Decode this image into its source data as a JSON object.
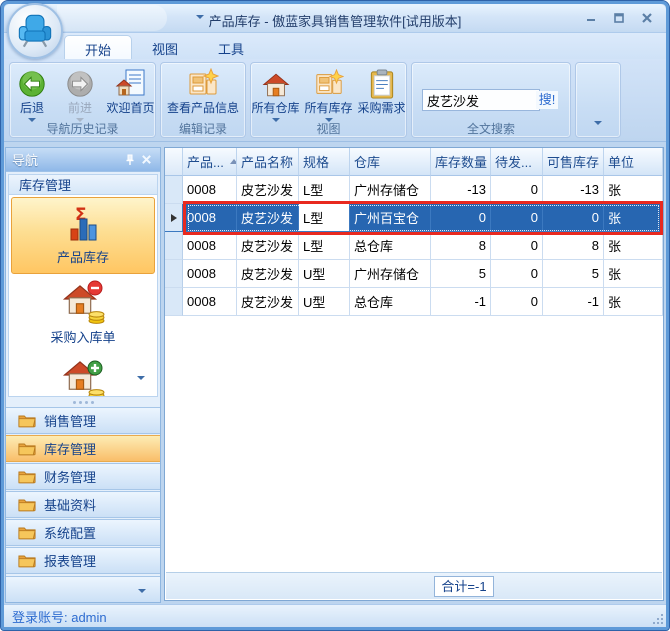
{
  "colors": {
    "selection_blue": "#2766B1",
    "highlight_red": "#E8291F",
    "selected_orange": "#FFC662",
    "accent_text_blue": "#15428B"
  },
  "titlebar": {
    "title": "产品库存 - 傲蓝家具销售管理软件[试用版本]"
  },
  "tabs": {
    "start": "开始",
    "view": "视图",
    "tools": "工具"
  },
  "ribbon": {
    "back": "后退",
    "forward": "前进",
    "welcome": "欢迎首页",
    "group_nav": "导航历史记录",
    "view_product": "查看产品信息",
    "group_edit": "编辑记录",
    "all_warehouses": "所有仓库",
    "all_stock": "所有库存",
    "purchase_demand": "采购需求",
    "group_view": "视图",
    "search_value": "皮艺沙发",
    "search_button": "搜!",
    "group_search": "全文搜索"
  },
  "sidebar": {
    "panel_title": "导航",
    "section": "库存管理",
    "item_product_stock": "产品库存",
    "item_purchase_in": "采购入库单",
    "groups": [
      "销售管理",
      "库存管理",
      "财务管理",
      "基础资料",
      "系统配置",
      "报表管理"
    ]
  },
  "table": {
    "columns": [
      "产品...",
      "产品名称",
      "规格",
      "仓库",
      "库存数量",
      "待发...",
      "可售库存",
      "单位"
    ],
    "rows": [
      [
        "0008",
        "皮艺沙发",
        "L型",
        "广州存储仓",
        "-13",
        "0",
        "-13",
        "张"
      ],
      [
        "0008",
        "皮艺沙发",
        "L型",
        "广州百宝仓",
        "0",
        "0",
        "0",
        "张"
      ],
      [
        "0008",
        "皮艺沙发",
        "L型",
        "总仓库",
        "8",
        "0",
        "8",
        "张"
      ],
      [
        "0008",
        "皮艺沙发",
        "U型",
        "广州存储仓",
        "5",
        "0",
        "5",
        "张"
      ],
      [
        "0008",
        "皮艺沙发",
        "U型",
        "总仓库",
        "-1",
        "0",
        "-1",
        "张"
      ]
    ],
    "selected_row_index": 1,
    "total": "合计=-1"
  },
  "statusbar": {
    "login": "登录账号: admin"
  }
}
